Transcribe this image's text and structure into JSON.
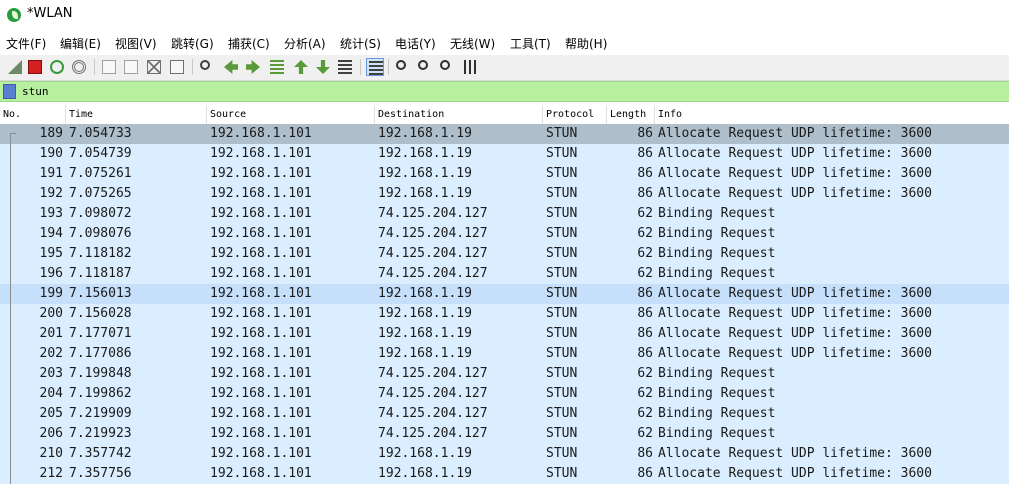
{
  "window": {
    "title": "*WLAN"
  },
  "menu": [
    "文件(F)",
    "编辑(E)",
    "视图(V)",
    "跳转(G)",
    "捕获(C)",
    "分析(A)",
    "统计(S)",
    "电话(Y)",
    "无线(W)",
    "工具(T)",
    "帮助(H)"
  ],
  "toolbar": {
    "buttons": [
      {
        "name": "start-capture-fin-icon",
        "color": "#6a8a6a"
      },
      {
        "name": "stop-capture-icon",
        "color": "#d42020"
      },
      {
        "name": "restart-capture-icon",
        "color": "#3a9a3a"
      },
      {
        "name": "capture-options-gear-icon",
        "color": "#707070"
      },
      {
        "name": "open-file-icon",
        "color": "#a0a0a0"
      },
      {
        "name": "save-file-icon",
        "color": "#a0a0a0"
      },
      {
        "name": "close-file-icon",
        "color": "#707070"
      },
      {
        "name": "reload-file-icon",
        "color": "#707070"
      },
      {
        "name": "find-packet-icon",
        "color": "#404040"
      },
      {
        "name": "go-back-icon",
        "color": "#5a9a3a"
      },
      {
        "name": "go-forward-icon",
        "color": "#5a9a3a"
      },
      {
        "name": "go-to-packet-icon",
        "color": "#5a9a3a"
      },
      {
        "name": "go-first-packet-icon",
        "color": "#5a9a3a"
      },
      {
        "name": "go-last-packet-icon",
        "color": "#5a9a3a"
      },
      {
        "name": "autoscroll-icon",
        "color": "#404040"
      },
      {
        "name": "colorize-icon",
        "color": "#404040"
      },
      {
        "name": "zoom-in-icon",
        "color": "#303030"
      },
      {
        "name": "zoom-out-icon",
        "color": "#303030"
      },
      {
        "name": "zoom-normal-icon",
        "color": "#303030"
      },
      {
        "name": "resize-columns-icon",
        "color": "#303030"
      }
    ]
  },
  "filter": {
    "value": "stun",
    "bg": "#b8f0a0"
  },
  "columns": [
    "No.",
    "Time",
    "Source",
    "Destination",
    "Protocol",
    "Length",
    "Info"
  ],
  "selected_row": 0,
  "hover_row": 8,
  "packets": [
    {
      "no": "189",
      "time": "7.054733",
      "source": "192.168.1.101",
      "destination": "192.168.1.19",
      "protocol": "STUN",
      "length": "86",
      "info": "Allocate Request UDP lifetime: 3600"
    },
    {
      "no": "190",
      "time": "7.054739",
      "source": "192.168.1.101",
      "destination": "192.168.1.19",
      "protocol": "STUN",
      "length": "86",
      "info": "Allocate Request UDP lifetime: 3600"
    },
    {
      "no": "191",
      "time": "7.075261",
      "source": "192.168.1.101",
      "destination": "192.168.1.19",
      "protocol": "STUN",
      "length": "86",
      "info": "Allocate Request UDP lifetime: 3600"
    },
    {
      "no": "192",
      "time": "7.075265",
      "source": "192.168.1.101",
      "destination": "192.168.1.19",
      "protocol": "STUN",
      "length": "86",
      "info": "Allocate Request UDP lifetime: 3600"
    },
    {
      "no": "193",
      "time": "7.098072",
      "source": "192.168.1.101",
      "destination": "74.125.204.127",
      "protocol": "STUN",
      "length": "62",
      "info": "Binding Request"
    },
    {
      "no": "194",
      "time": "7.098076",
      "source": "192.168.1.101",
      "destination": "74.125.204.127",
      "protocol": "STUN",
      "length": "62",
      "info": "Binding Request"
    },
    {
      "no": "195",
      "time": "7.118182",
      "source": "192.168.1.101",
      "destination": "74.125.204.127",
      "protocol": "STUN",
      "length": "62",
      "info": "Binding Request"
    },
    {
      "no": "196",
      "time": "7.118187",
      "source": "192.168.1.101",
      "destination": "74.125.204.127",
      "protocol": "STUN",
      "length": "62",
      "info": "Binding Request"
    },
    {
      "no": "199",
      "time": "7.156013",
      "source": "192.168.1.101",
      "destination": "192.168.1.19",
      "protocol": "STUN",
      "length": "86",
      "info": "Allocate Request UDP lifetime: 3600"
    },
    {
      "no": "200",
      "time": "7.156028",
      "source": "192.168.1.101",
      "destination": "192.168.1.19",
      "protocol": "STUN",
      "length": "86",
      "info": "Allocate Request UDP lifetime: 3600"
    },
    {
      "no": "201",
      "time": "7.177071",
      "source": "192.168.1.101",
      "destination": "192.168.1.19",
      "protocol": "STUN",
      "length": "86",
      "info": "Allocate Request UDP lifetime: 3600"
    },
    {
      "no": "202",
      "time": "7.177086",
      "source": "192.168.1.101",
      "destination": "192.168.1.19",
      "protocol": "STUN",
      "length": "86",
      "info": "Allocate Request UDP lifetime: 3600"
    },
    {
      "no": "203",
      "time": "7.199848",
      "source": "192.168.1.101",
      "destination": "74.125.204.127",
      "protocol": "STUN",
      "length": "62",
      "info": "Binding Request"
    },
    {
      "no": "204",
      "time": "7.199862",
      "source": "192.168.1.101",
      "destination": "74.125.204.127",
      "protocol": "STUN",
      "length": "62",
      "info": "Binding Request"
    },
    {
      "no": "205",
      "time": "7.219909",
      "source": "192.168.1.101",
      "destination": "74.125.204.127",
      "protocol": "STUN",
      "length": "62",
      "info": "Binding Request"
    },
    {
      "no": "206",
      "time": "7.219923",
      "source": "192.168.1.101",
      "destination": "74.125.204.127",
      "protocol": "STUN",
      "length": "62",
      "info": "Binding Request"
    },
    {
      "no": "210",
      "time": "7.357742",
      "source": "192.168.1.101",
      "destination": "192.168.1.19",
      "protocol": "STUN",
      "length": "86",
      "info": "Allocate Request UDP lifetime: 3600"
    },
    {
      "no": "212",
      "time": "7.357756",
      "source": "192.168.1.101",
      "destination": "192.168.1.19",
      "protocol": "STUN",
      "length": "86",
      "info": "Allocate Request UDP lifetime: 3600"
    }
  ]
}
